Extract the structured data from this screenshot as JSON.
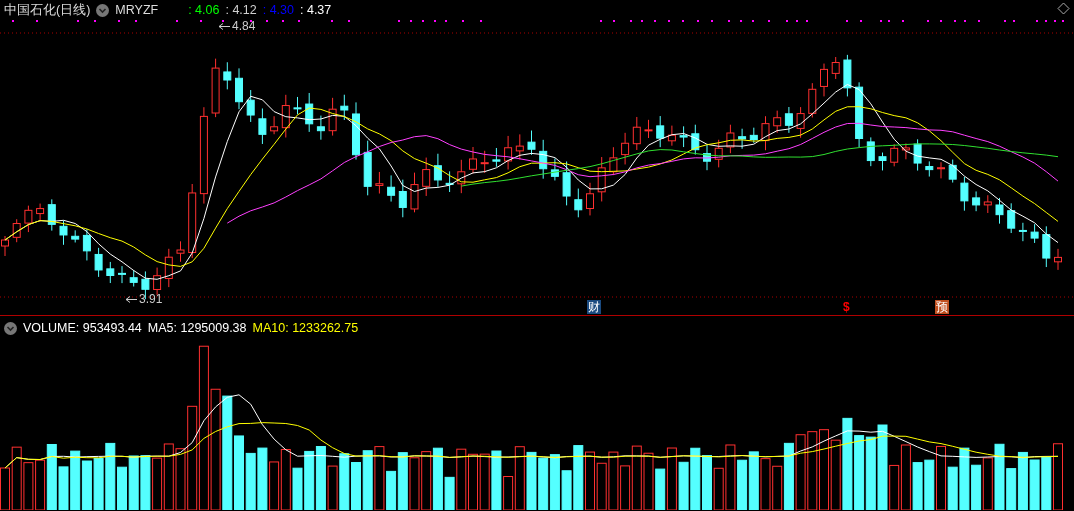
{
  "price_header": {
    "title": "中国石化(日线)",
    "indicator": "MRYZF",
    "readings": [
      {
        "text": ": 4.06",
        "color": "#00ff00"
      },
      {
        "text": ": 4.12",
        "color": "#d0d0d0"
      },
      {
        "text": ": 4.30",
        "color": "#0000ff"
      },
      {
        "text": ": 4.37",
        "color": "#ffffff"
      }
    ]
  },
  "annotations": [
    {
      "kind": "high",
      "text": "4.84"
    },
    {
      "kind": "low",
      "text": "3.91"
    }
  ],
  "event_markers": [
    {
      "kind": "badge",
      "text": "财",
      "color": "#1a4a80"
    },
    {
      "kind": "glyph",
      "text": "$",
      "color": "#ff0000"
    },
    {
      "kind": "badge",
      "text": "预",
      "color": "#c05020"
    }
  ],
  "volume_header": {
    "readings": [
      {
        "text": "VOLUME: 953493.44",
        "color": "#ffffff"
      },
      {
        "text": "MA5: 1295009.38",
        "color": "#ffffff"
      },
      {
        "text": "MA10: 1233262.75",
        "color": "#ffff00"
      }
    ]
  }
}
